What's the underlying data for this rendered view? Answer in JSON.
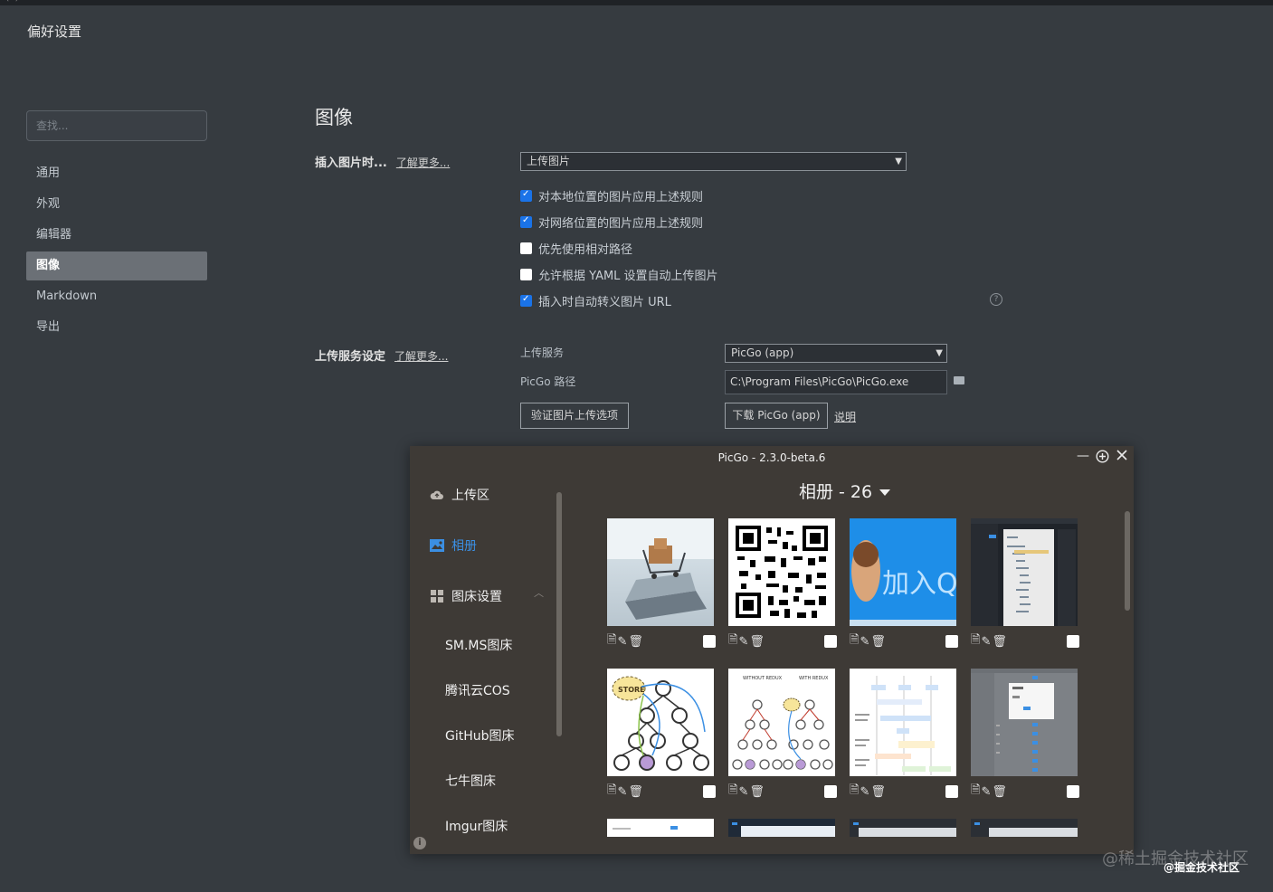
{
  "window": {
    "title": "偏好设置",
    "top_fragment": "..(..)"
  },
  "sidebar": {
    "search_placeholder": "查找...",
    "items": [
      {
        "label": "通用"
      },
      {
        "label": "外观"
      },
      {
        "label": "编辑器"
      },
      {
        "label": "图像"
      },
      {
        "label": "Markdown"
      },
      {
        "label": "导出"
      }
    ],
    "active_index": 3
  },
  "main": {
    "section_title": "图像",
    "insert": {
      "label": "插入图片时...",
      "learn_more": "了解更多...",
      "select_value": "上传图片"
    },
    "checkboxes": [
      {
        "label": "对本地位置的图片应用上述规则",
        "checked": true
      },
      {
        "label": "对网络位置的图片应用上述规则",
        "checked": true
      },
      {
        "label": "优先使用相对路径",
        "checked": false
      },
      {
        "label": "允许根据 YAML 设置自动上传图片",
        "checked": false
      },
      {
        "label": "插入时自动转义图片 URL",
        "checked": true
      }
    ],
    "upload": {
      "label": "上传服务设定",
      "learn_more": "了解更多...",
      "service_label": "上传服务",
      "service_value": "PicGo (app)",
      "path_label": "PicGo 路径",
      "path_value": "C:\\Program Files\\PicGo\\PicGo.exe",
      "verify_button": "验证图片上传选项",
      "download_button": "下载 PicGo (app)",
      "explain_link": "说明"
    }
  },
  "picgo": {
    "title": "PicGo - 2.3.0-beta.6",
    "nav": [
      {
        "label": "上传区",
        "icon": "cloud-upload-icon"
      },
      {
        "label": "相册",
        "icon": "image-icon"
      },
      {
        "label": "图床设置",
        "icon": "grid-icon"
      }
    ],
    "hosts": [
      "SM.MS图床",
      "腾讯云COS",
      "GitHub图床",
      "七牛图床",
      "Imgur图床"
    ],
    "gallery_title": "相册 - 26",
    "thumbnails": [
      {
        "image": "shopping-cart-laptop"
      },
      {
        "image": "qr-code"
      },
      {
        "image": "join-qq-group-banner"
      },
      {
        "image": "app-screenshot-dark"
      },
      {
        "image": "store-tree-diagram"
      },
      {
        "image": "with-without-redux-diagram"
      },
      {
        "image": "flow-diagram"
      },
      {
        "image": "app-screenshot-gray"
      }
    ],
    "thumb_texts": {
      "join_qq": "加入QQ群",
      "store": "STORE",
      "without_redux": "WITHOUT REDUX",
      "with_redux": "WITH REDUX"
    }
  },
  "watermark": {
    "main": "@稀土掘金技术社区",
    "small": "@掘金技术社区"
  },
  "colors": {
    "accent": "#1a73e8",
    "picgo_active": "#3b8fe3",
    "bg": "#363b40",
    "picgo_bg": "#3e3a36"
  }
}
